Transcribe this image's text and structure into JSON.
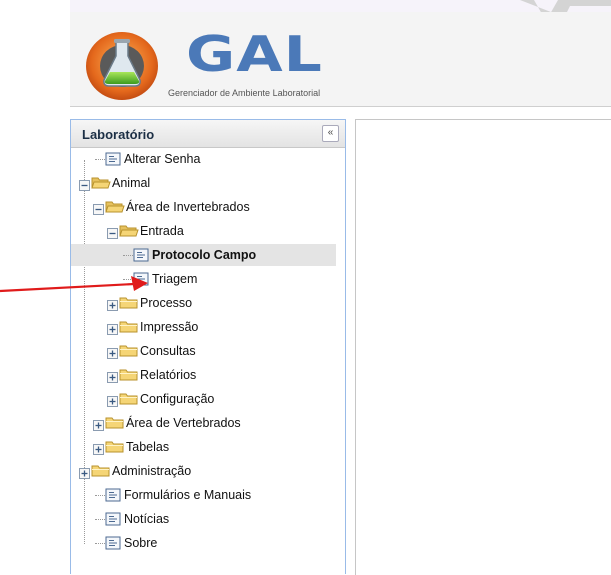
{
  "header": {
    "logo_text": "GAL",
    "logo_subtitle": "Gerenciador de Ambiente Laboratorial"
  },
  "left_panel": {
    "title": "Laboratório",
    "collapse_glyph": "«"
  },
  "tree": [
    {
      "label": "Alterar Senha",
      "type": "leaf",
      "depth": 1
    },
    {
      "label": "Animal",
      "type": "folder-open",
      "depth": 0
    },
    {
      "label": "Área de Invertebrados",
      "type": "folder-open",
      "depth": 1
    },
    {
      "label": "Entrada",
      "type": "folder-open",
      "depth": 2
    },
    {
      "label": "Protocolo Campo",
      "type": "leaf",
      "depth": 3,
      "selected": true
    },
    {
      "label": "Triagem",
      "type": "leaf",
      "depth": 3
    },
    {
      "label": "Processo",
      "type": "folder-closed",
      "depth": 2
    },
    {
      "label": "Impressão",
      "type": "folder-closed",
      "depth": 2
    },
    {
      "label": "Consultas",
      "type": "folder-closed",
      "depth": 2
    },
    {
      "label": "Relatórios",
      "type": "folder-closed",
      "depth": 2
    },
    {
      "label": "Configuração",
      "type": "folder-closed",
      "depth": 2
    },
    {
      "label": "Área de Vertebrados",
      "type": "folder-closed",
      "depth": 1
    },
    {
      "label": "Tabelas",
      "type": "folder-closed",
      "depth": 1
    },
    {
      "label": "Administração",
      "type": "folder-closed",
      "depth": 0
    },
    {
      "label": "Formulários e Manuais",
      "type": "leaf",
      "depth": 1
    },
    {
      "label": "Notícias",
      "type": "leaf",
      "depth": 1
    },
    {
      "label": "Sobre",
      "type": "leaf",
      "depth": 1
    }
  ],
  "colors": {
    "annotation_arrow": "#e01b1b",
    "folder": "#f5d576",
    "logo_blue": "#4b79b8"
  },
  "icons": {
    "leaf": "page-icon",
    "folder": "folder-icon",
    "expand": "plus-toggle-icon",
    "collapse": "minus-toggle-icon"
  }
}
